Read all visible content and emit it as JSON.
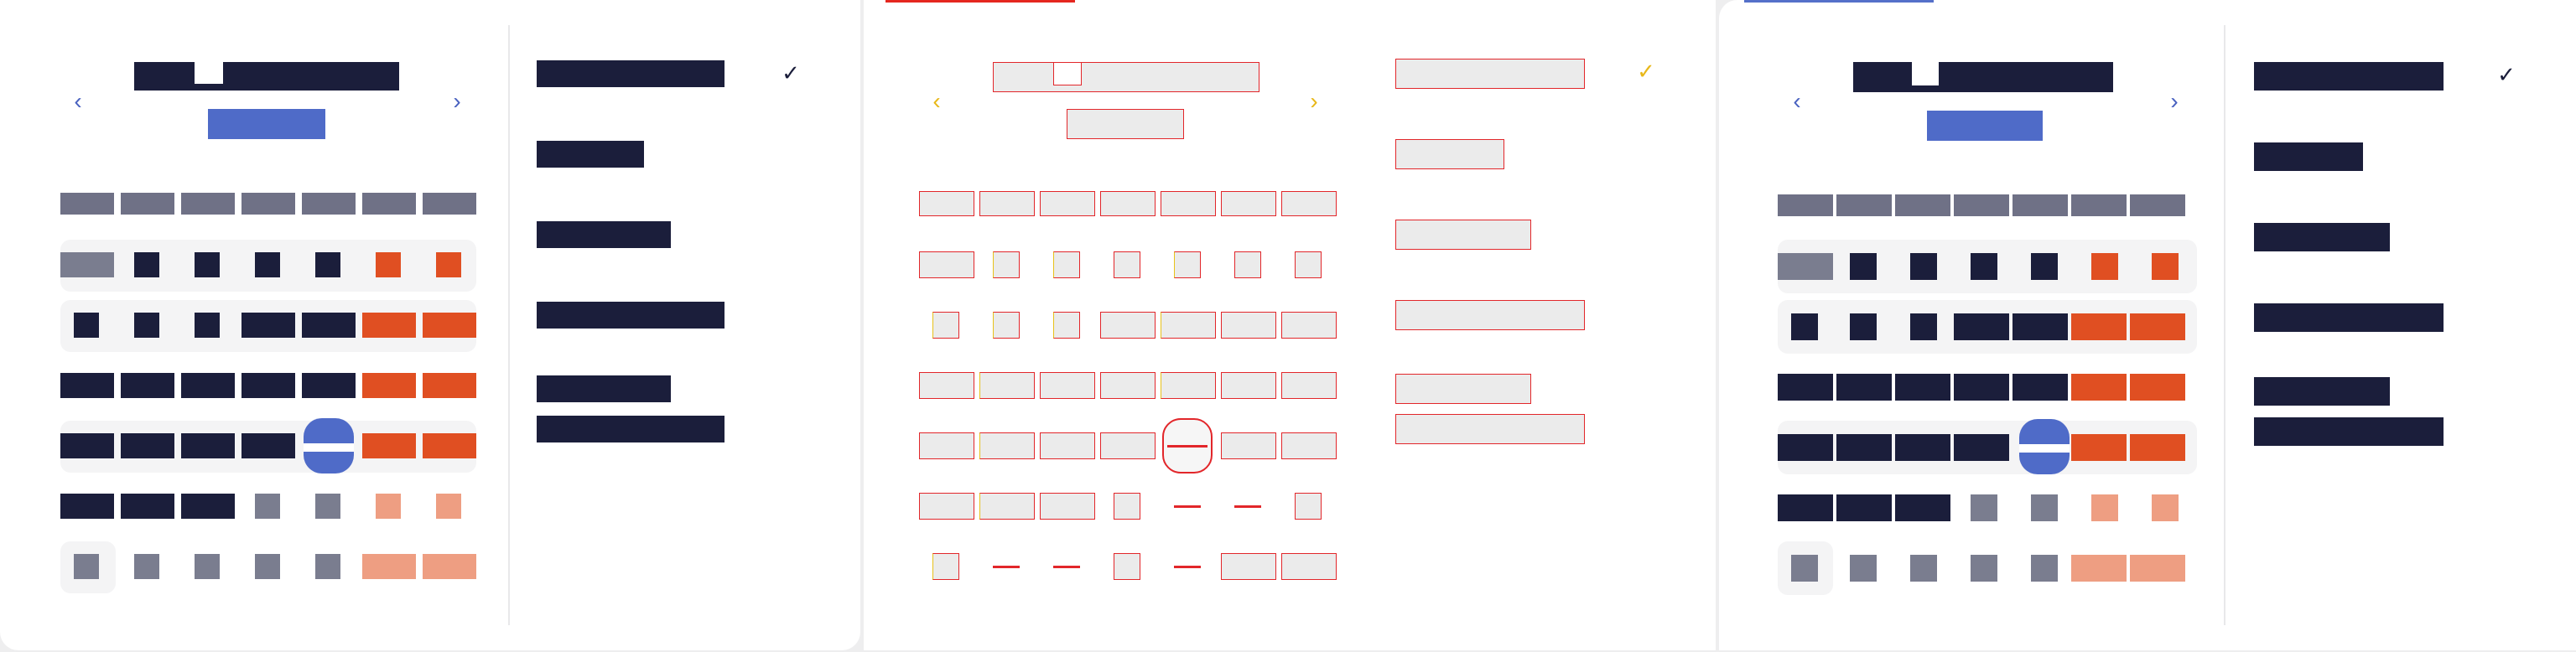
{
  "calendar": {
    "prev_label": "‹",
    "next_label": "›",
    "check_glyph": "✓",
    "selected_label": "",
    "colors": {
      "text_block": "#1b1e3b",
      "muted": "#7a7d8f",
      "weekend": "#e04f22",
      "weekend_muted": "#ee9e82",
      "accent": "#4f6bc8",
      "wireframe_border": "#e2262a",
      "wireframe_highlight": "#e8c21a"
    },
    "icons": [
      "chevron-left-icon",
      "chevron-right-icon",
      "check-icon"
    ]
  }
}
